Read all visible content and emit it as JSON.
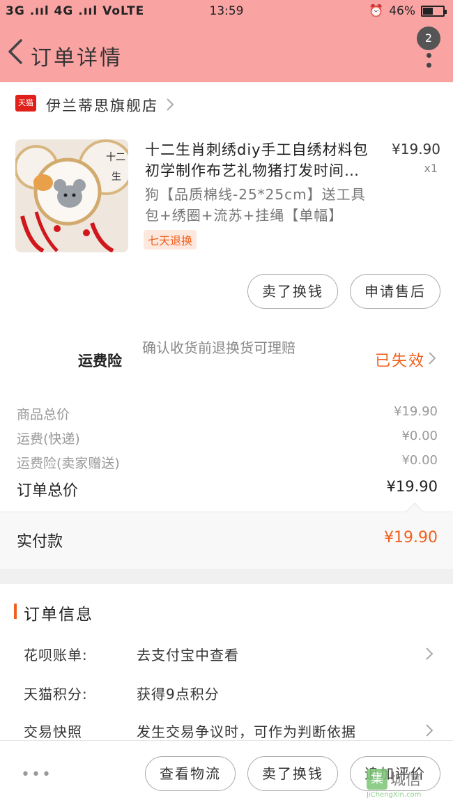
{
  "status_bar": {
    "left": "3G .ııl 4G .ııl VoLTE",
    "time": "13:59",
    "battery": "46%",
    "battery_level": 0.46
  },
  "nav": {
    "title": "订单详情",
    "badge": "2"
  },
  "store": {
    "logo_text": "天猫",
    "name": "伊兰蒂思旗舰店"
  },
  "product": {
    "title": "十二生肖刺绣diy手工自绣材料包初学制作布艺礼物猪打发时间…",
    "price": "¥19.90",
    "qty": "x1",
    "spec": "狗【品质棉线-25*25cm】送工具包+绣圈+流苏+挂绳【单幅】",
    "tag": "七天退换"
  },
  "product_actions": {
    "sell": "卖了换钱",
    "after_sale": "申请售后"
  },
  "insurance": {
    "label": "运费险",
    "desc": "确认收货前退换货可理赔",
    "status": "已失效"
  },
  "summary": {
    "goods_total_label": "商品总价",
    "goods_total": "¥19.90",
    "shipping_label": "运费(快递)",
    "shipping": "¥0.00",
    "insurance_label": "运费险(卖家赠送)",
    "insurance": "¥0.00",
    "order_total_label": "订单总价",
    "order_total": "¥19.90"
  },
  "paid": {
    "label": "实付款",
    "value": "¥19.90"
  },
  "order_info": {
    "title": "订单信息",
    "rows": [
      {
        "label": "花呗账单:",
        "value": "去支付宝中查看"
      },
      {
        "label": "天猫积分:",
        "value": "获得9点积分"
      },
      {
        "label": "交易快照",
        "value": "发生交易争议时，可作为判断依据"
      }
    ]
  },
  "bottom_bar": {
    "more": "•••",
    "logistics": "查看物流",
    "sell": "卖了换钱",
    "review": "追加评价"
  },
  "watermark": {
    "text": "城信",
    "icon_text": "集",
    "sub": "JiChengXin.com"
  },
  "colors": {
    "header_bg": "#f9a3a3",
    "accent": "#f0601f",
    "tmall_red": "#e0201a"
  }
}
